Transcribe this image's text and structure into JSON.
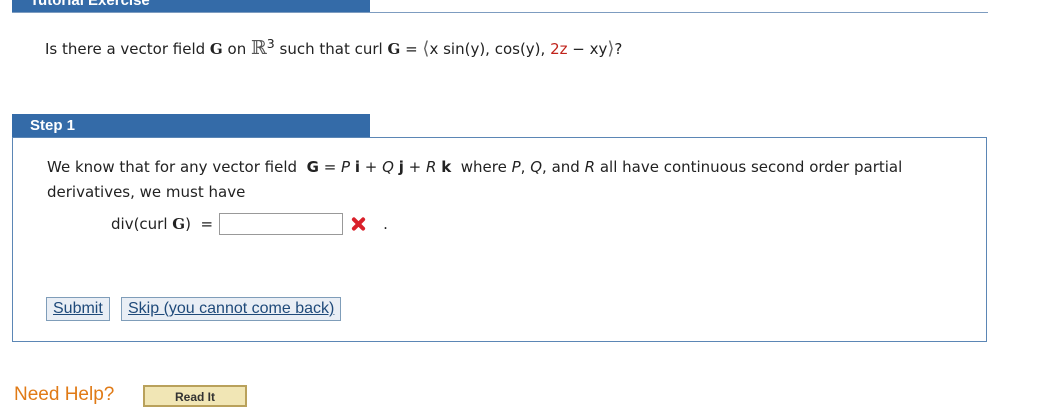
{
  "tutorial": {
    "header": "Tutorial Exercise"
  },
  "question": {
    "prefix": "Is there a vector field",
    "field": "G",
    "on": "on",
    "space": "ℝ",
    "exp": "3",
    "such": "such that curl",
    "curl_field": "G",
    "eq": "=",
    "open": "⟨",
    "comp1": "x sin(y), cos(y),",
    "comp3_red": "2z",
    "comp3_rest": "− xy",
    "close": "⟩",
    "qmark": "?"
  },
  "step": {
    "header": "Step 1",
    "line1_a": "We know that for any vector field",
    "eq_G": "G",
    "eq_mid": "= P",
    "i": "i",
    "plus_q": "+ Q",
    "j": "j",
    "plus_r": "+ R",
    "k": "k",
    "where": "where",
    "P": "P",
    "Q": "Q",
    "and": "and",
    "R": "R",
    "line1_b": "all have continuous second order partial derivatives, we must have",
    "div_label": "div(curl",
    "div_G": "G",
    "div_close": ")",
    "eq": "=",
    "answer_value": "",
    "dot": ".",
    "submit_label": "Submit",
    "skip_label": "Skip (you cannot come back)"
  },
  "help": {
    "label": "Need Help?",
    "read_label": "Read It"
  },
  "colors": {
    "header_bg": "#346ba8",
    "error": "#d9202a",
    "help": "#e07a16"
  }
}
